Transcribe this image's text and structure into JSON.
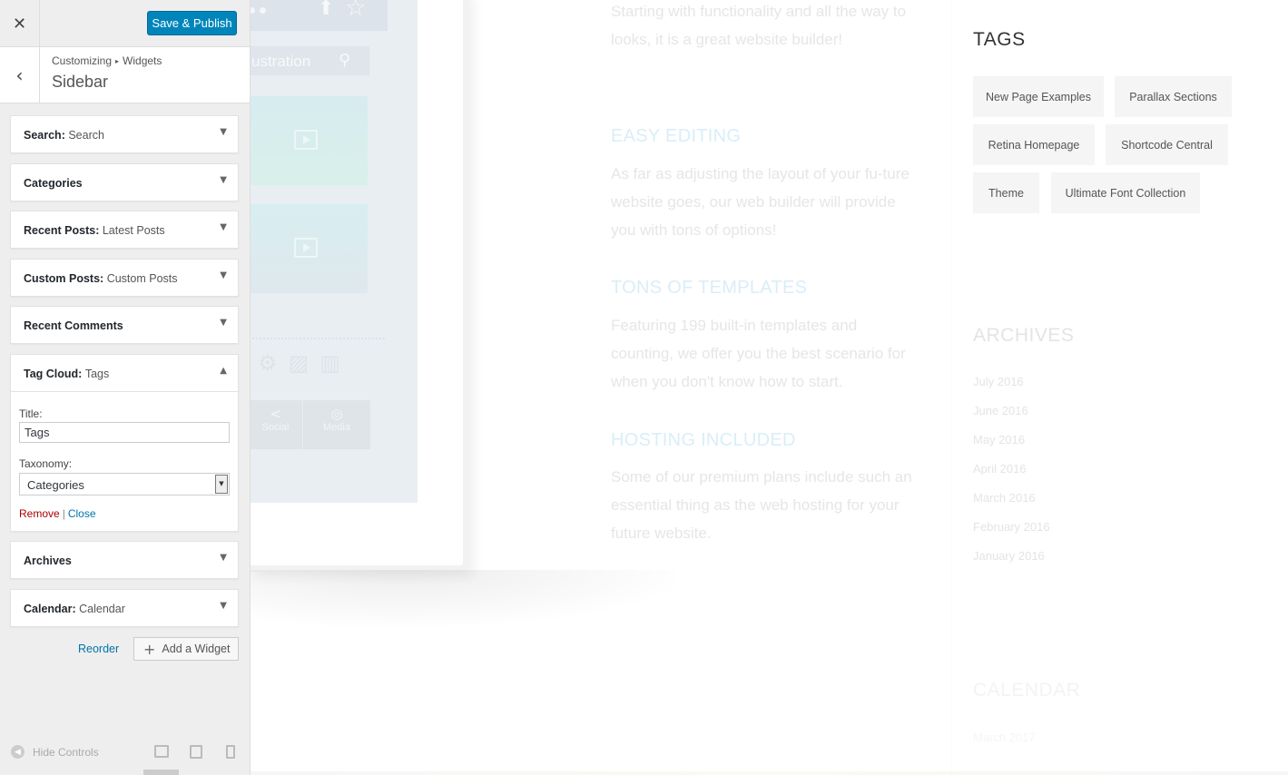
{
  "customizer": {
    "close_icon": "close-icon",
    "save_label": "Save & Publish",
    "back_icon": "chevron-left-icon",
    "breadcrumb": {
      "root": "Customizing",
      "separator": "▸",
      "current": "Widgets"
    },
    "section_title": "Sidebar",
    "widgets": [
      {
        "title": "Search:",
        "subtitle": "Search",
        "expanded": false
      },
      {
        "title": "Categories",
        "subtitle": "",
        "expanded": false
      },
      {
        "title": "Recent Posts:",
        "subtitle": "Latest Posts",
        "expanded": false
      },
      {
        "title": "Custom Posts:",
        "subtitle": "Custom Posts",
        "expanded": false
      },
      {
        "title": "Recent Comments",
        "subtitle": "",
        "expanded": false
      },
      {
        "title": "Tag Cloud:",
        "subtitle": "Tags",
        "expanded": true
      },
      {
        "title": "Archives",
        "subtitle": "",
        "expanded": false
      },
      {
        "title": "Calendar:",
        "subtitle": "Calendar",
        "expanded": false
      }
    ],
    "tag_cloud_form": {
      "title_label": "Title:",
      "title_value": "Tags",
      "taxonomy_label": "Taxonomy:",
      "taxonomy_value": "Categories",
      "remove_label": "Remove",
      "separator": "|",
      "close_label": "Close"
    },
    "reorder_label": "Reorder",
    "add_widget_label": "Add a Widget",
    "hide_controls_label": "Hide Controls",
    "devices": [
      "desktop-icon",
      "tablet-icon",
      "mobile-icon"
    ]
  },
  "preview": {
    "mock_device": {
      "search_text": "ustration",
      "tabs": [
        "Social",
        "Media"
      ]
    },
    "features": {
      "intro": "Starting with functionality and all the way to looks, it is a great website builder!",
      "items": [
        {
          "heading": "EASY EDITING",
          "text": "As far as adjusting the layout of your fu-ture website goes, our web builder will provide you with tons of options!"
        },
        {
          "heading": "TONS OF TEMPLATES",
          "text": "Featuring 199 built-in templates and counting, we offer you the best scenario for when you don't know how to start."
        },
        {
          "heading": "HOSTING INCLUDED",
          "text": "Some of our premium plans include such an essential thing as the web hosting for your future website."
        }
      ]
    },
    "sidebar": {
      "tags_title": "TAGS",
      "tags": [
        "New Page Examples",
        "Parallax Sections",
        "Retina Homepage",
        "Shortcode Central",
        "Theme",
        "Ultimate Font Collection"
      ],
      "archives_title": "ARCHIVES",
      "archives": [
        "July 2016",
        "June 2016",
        "May 2016",
        "April 2016",
        "March 2016",
        "February 2016",
        "January 2016"
      ],
      "calendar_title": "CALENDAR",
      "calendar_month": "March 2017"
    }
  },
  "colors": {
    "primary_button": "#0085ba",
    "link": "#0073aa",
    "remove_link": "#aa0000",
    "panel_bg": "#eeeeee"
  }
}
